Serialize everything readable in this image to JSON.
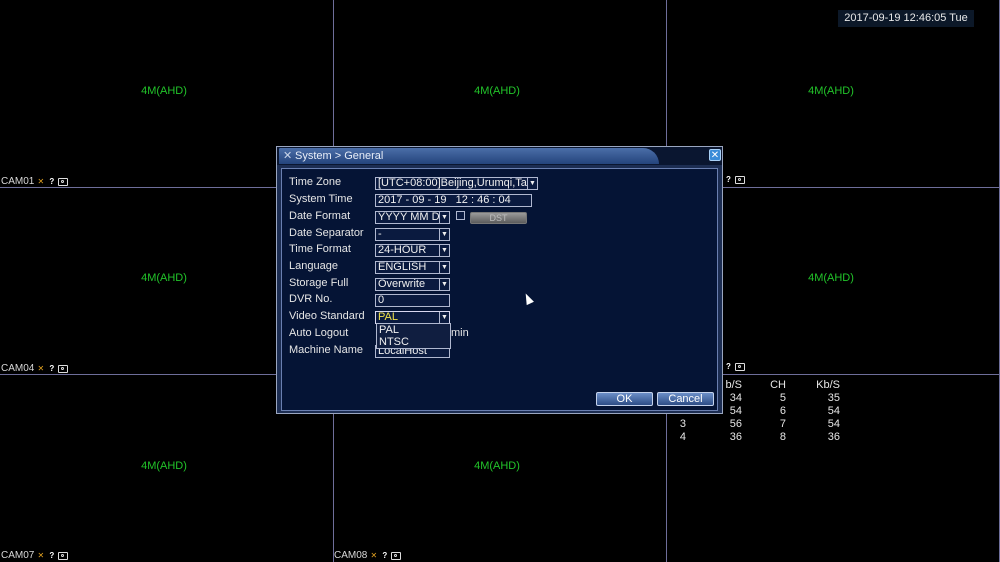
{
  "clock": "2017-09-19 12:46:05 Tue",
  "channels": [
    {
      "name": "CAM01",
      "res": "4M(AHD)"
    },
    {
      "name": "",
      "res": "4M(AHD)"
    },
    {
      "name": "",
      "res": "4M(AHD)"
    },
    {
      "name": "CAM04",
      "res": "4M(AHD)"
    },
    {
      "name": "",
      "res": "4M(AHD)"
    },
    {
      "name": "",
      "res": "4M(AHD)"
    },
    {
      "name": "CAM07",
      "res": "4M(AHD)"
    },
    {
      "name": "CAM08",
      "res": "4M(AHD)"
    }
  ],
  "stats": {
    "header": {
      "kbs1": "b/S",
      "ch": "CH",
      "kbs2": "Kb/S"
    },
    "rows": [
      {
        "ch1": "",
        "kbs1": "34",
        "ch2": "5",
        "kbs2": "35"
      },
      {
        "ch1": "",
        "kbs1": "54",
        "ch2": "6",
        "kbs2": "54"
      },
      {
        "ch1": "3",
        "kbs1": "56",
        "ch2": "7",
        "kbs2": "54"
      },
      {
        "ch1": "4",
        "kbs1": "36",
        "ch2": "8",
        "kbs2": "36"
      }
    ]
  },
  "dialog": {
    "title": "System > General",
    "labels": {
      "time_zone": "Time Zone",
      "system_time": "System Time",
      "date_format": "Date Format",
      "date_separator": "Date Separator",
      "time_format": "Time Format",
      "language": "Language",
      "storage_full": "Storage Full",
      "dvr_no": "DVR No.",
      "video_standard": "Video Standard",
      "auto_logout": "Auto Logout",
      "machine_name": "Machine Name"
    },
    "values": {
      "time_zone": "[UTC+08:00]Beijing,Urumqi,Ta",
      "system_date": "2017 - 09 - 19",
      "system_clock": "12 : 46 : 04",
      "date_format": "YYYY MM DD",
      "date_separator": "-",
      "time_format": "24-HOUR",
      "language": "ENGLISH",
      "storage_full": "Overwrite",
      "dvr_no": "0",
      "video_standard": "PAL",
      "auto_logout_unit": "min",
      "machine_name": "LocalHost"
    },
    "video_standard_options": [
      "PAL",
      "NTSC"
    ],
    "dst_button": "DST",
    "ok": "OK",
    "cancel": "Cancel"
  }
}
